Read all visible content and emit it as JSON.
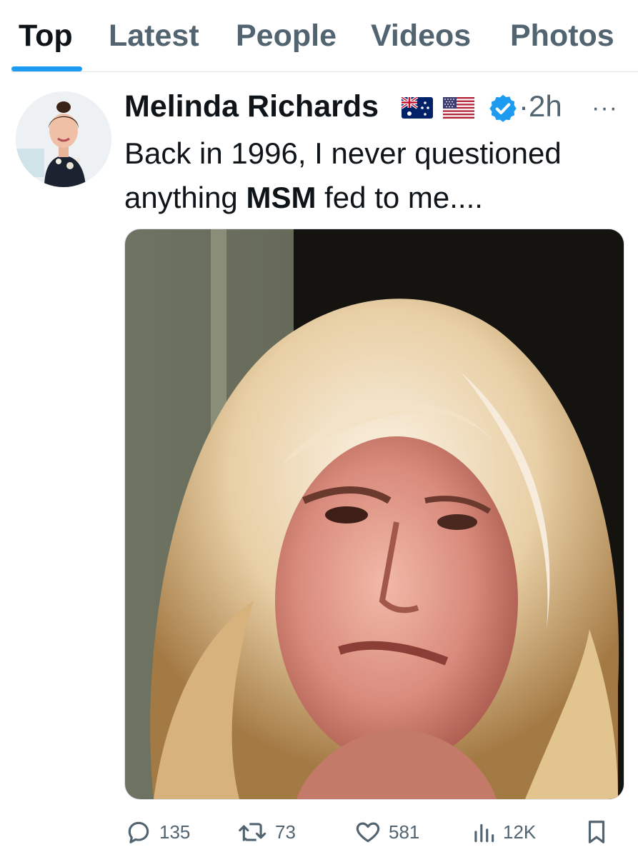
{
  "tabs": [
    {
      "label": "Top",
      "active": true
    },
    {
      "label": "Latest",
      "active": false
    },
    {
      "label": "People",
      "active": false
    },
    {
      "label": "Videos",
      "active": false
    },
    {
      "label": "Photos",
      "active": false
    }
  ],
  "tweet": {
    "author_name": "Melinda Richards",
    "flags": [
      "australia-flag",
      "usa-flag"
    ],
    "verified": true,
    "time": "2h",
    "separator": "·",
    "text_prefix": "Back in 1996, I never questioned anything ",
    "text_bold": "MSM",
    "text_suffix": " fed to me....",
    "media": "photo"
  },
  "actions": {
    "replies": "135",
    "reposts": "73",
    "likes": "581",
    "views": "12K"
  },
  "colors": {
    "accent": "#1d9bf0",
    "secondary_text": "#536471",
    "primary_text": "#0f1419"
  }
}
